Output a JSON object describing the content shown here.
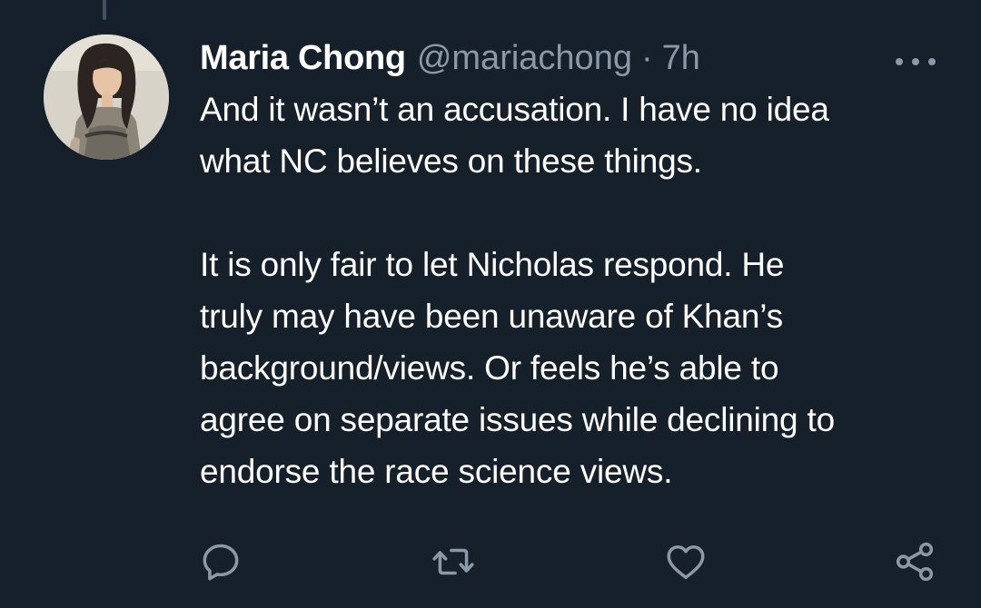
{
  "tweet": {
    "display_name": "Maria Chong",
    "handle": "@mariachong",
    "separator": "·",
    "time": "7h",
    "paragraphs": [
      "And it wasn’t an accusation. I have no idea\nwhat NC believes on these things.",
      "It is only fair to let Nicholas respond. He\ntruly may have been unaware of Khan’s\nbackground/views. Or feels he’s able to\nagree on separate issues while declining to\nendorse the race science views."
    ]
  },
  "icons": {
    "more": "more-horizontal-icon",
    "reply": "reply-icon",
    "retweet": "retweet-icon",
    "like": "heart-icon",
    "share": "share-icon"
  },
  "colors": {
    "background": "#15202b",
    "primary_text": "#ffffff",
    "secondary_text": "#8b98a5",
    "thread_line": "#3d5466"
  }
}
